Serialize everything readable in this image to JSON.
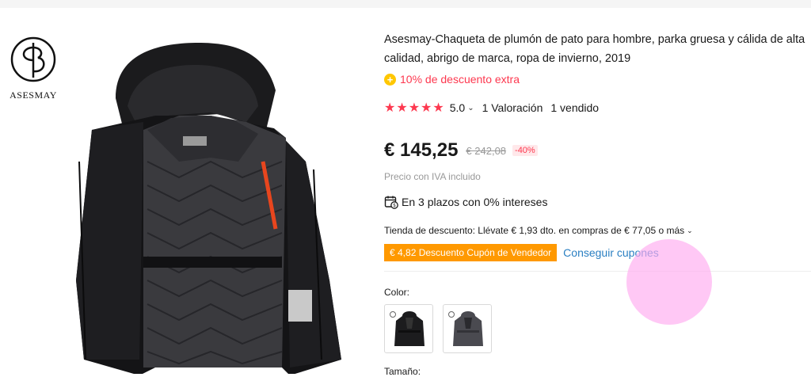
{
  "brand": {
    "name": "ASESMAY",
    "logo_icon": "asesmay-monogram-icon"
  },
  "product": {
    "title": "Asesmay-Chaqueta de plumón de pato para hombre, parka gruesa y cálida de alta calidad, abrigo de marca, ropa de invierno, 2019",
    "promo_text": "10% de descuento extra",
    "rating": {
      "stars": 5,
      "score": "5.0",
      "reviews": "1 Valoración",
      "sold": "1 vendido"
    },
    "price": "€ 145,25",
    "old_price": "€ 242,08",
    "discount_badge": "-40%",
    "vat_note": "Precio con IVA incluido",
    "installments": "En 3 plazos con 0% intereses",
    "store_discount": "Tienda de descuento: Llévate € 1,93 dto. en compras de € 77,05 o más",
    "coupon_label": "€ 4,82 Descuento Cupón de Vendedor",
    "get_coupons": "Conseguir cupones",
    "color_label": "Color:",
    "color_options": [
      "black-jacket",
      "grey-jacket"
    ],
    "size_label": "Tamaño:"
  },
  "colors": {
    "accent_red": "#fd384f",
    "coupon_orange": "#ff9900",
    "link_blue": "#2a7fc2",
    "promo_coin": "#ffc700"
  }
}
